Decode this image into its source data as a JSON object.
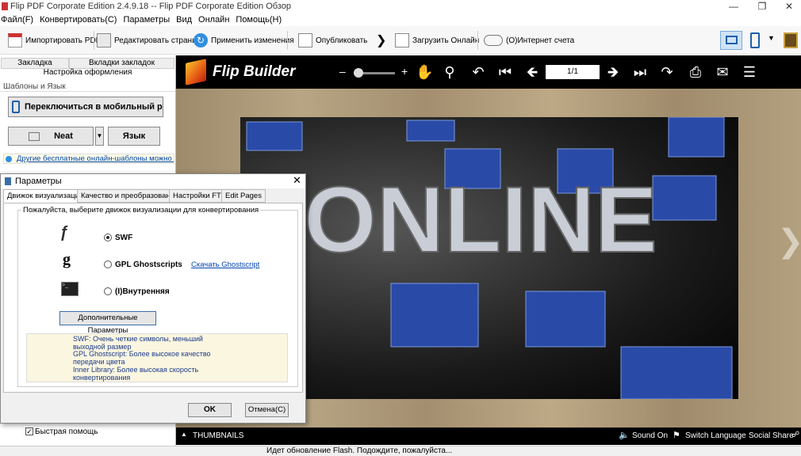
{
  "window": {
    "title": "Flip PDF Corporate Edition 2.4.9.18 -- Flip PDF Corporate Edition Обзор"
  },
  "menu": [
    "Файл(F)",
    "Конвертировать(C)",
    "Параметры",
    "Вид",
    "Онлайн",
    "Помощь(H)"
  ],
  "toolbar": {
    "import": "Импортировать PDF(I)",
    "edit": "Редактировать страниц",
    "apply": "Применить изменения",
    "publish": "Опубликовать",
    "upload": "Загрузить Онлайн",
    "account": "(O)Интернет счета"
  },
  "left": {
    "tab_bookmark": "Закладка",
    "tab_bookmarks": "Вкладки закладок",
    "design": "Настройка оформления",
    "templates": "Шаблоны и Язык",
    "mobile_btn": "Переключиться в мобильный режи",
    "theme": "Neat",
    "language": "Язык",
    "link": "Другие бесплатные онлайн-шаблоны можно н",
    "quickhelp": "Быстрая помощь"
  },
  "flip": {
    "logo": "Flip Builder",
    "page": "1/1",
    "thumbnails": "THUMBNAILS",
    "sound": "Sound On",
    "switch_lang": "Switch Language",
    "social": "Social Share"
  },
  "book": {
    "word": "ONLINE"
  },
  "status": "Идет обновление Flash. Подождите, пожалуйста...",
  "dialog": {
    "title": "Параметры",
    "tabs": [
      "Движок визуализации",
      "Качество и преобразование",
      "Настройки FTP",
      "Edit Pages"
    ],
    "group": "Пожалуйста, выберите движок визуализации для конвертирования",
    "opt_swf": "SWF",
    "opt_gpl": "GPL Ghostscripts",
    "download": "Скачать Ghostscript",
    "opt_inner": "(I)Внутренняя б",
    "advanced": "Дополнительные Параметры",
    "info": [
      "SWF: Очень четкие символы, меньший",
      "выходной размер",
      "GPL Ghostscript: Более высокое качество",
      "передачи цвета",
      "Inner Library: Более высокая скорость",
      "конвертирования"
    ],
    "ok": "OK",
    "cancel": "Отмена(C)"
  }
}
